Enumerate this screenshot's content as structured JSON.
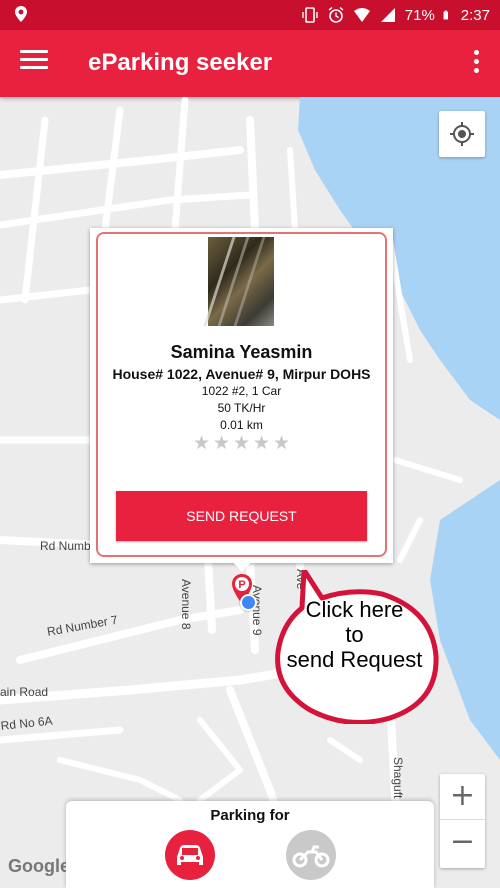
{
  "status_bar": {
    "battery": "71%",
    "time": "2:37"
  },
  "app_bar": {
    "title": "eParking seeker"
  },
  "popup": {
    "name": "Samina Yeasmin",
    "address": "House# 1022, Avenue# 9, Mirpur DOHS",
    "slot": "1022 #2, 1 Car",
    "rate": "50 TK/Hr",
    "distance": "0.01 km",
    "rating": 0,
    "max_rating": 5,
    "send_button": "SEND REQUEST"
  },
  "callout": {
    "line1": "Click here",
    "line2": "to",
    "line3": "send Request"
  },
  "map": {
    "road_labels": {
      "rd_number": "Rd Numb",
      "avenue_8": "Avenue 8",
      "avenue_9": "Avenue 9",
      "ave_partial": "Ave",
      "rd_number_7": "Rd Number 7",
      "main_road": "ain Road",
      "rd_no_6a": "Rd No 6A",
      "shaguf": "Shaguft"
    },
    "zoom_in": "+",
    "zoom_out": "−",
    "attribution": "Google"
  },
  "bottom_sheet": {
    "title": "Parking for",
    "options": [
      "car",
      "motorbike"
    ],
    "selected": "car"
  },
  "colors": {
    "primary": "#e8213e",
    "status_bar": "#c8102e",
    "water": "#a9d3f5",
    "map_land": "#ececec"
  }
}
